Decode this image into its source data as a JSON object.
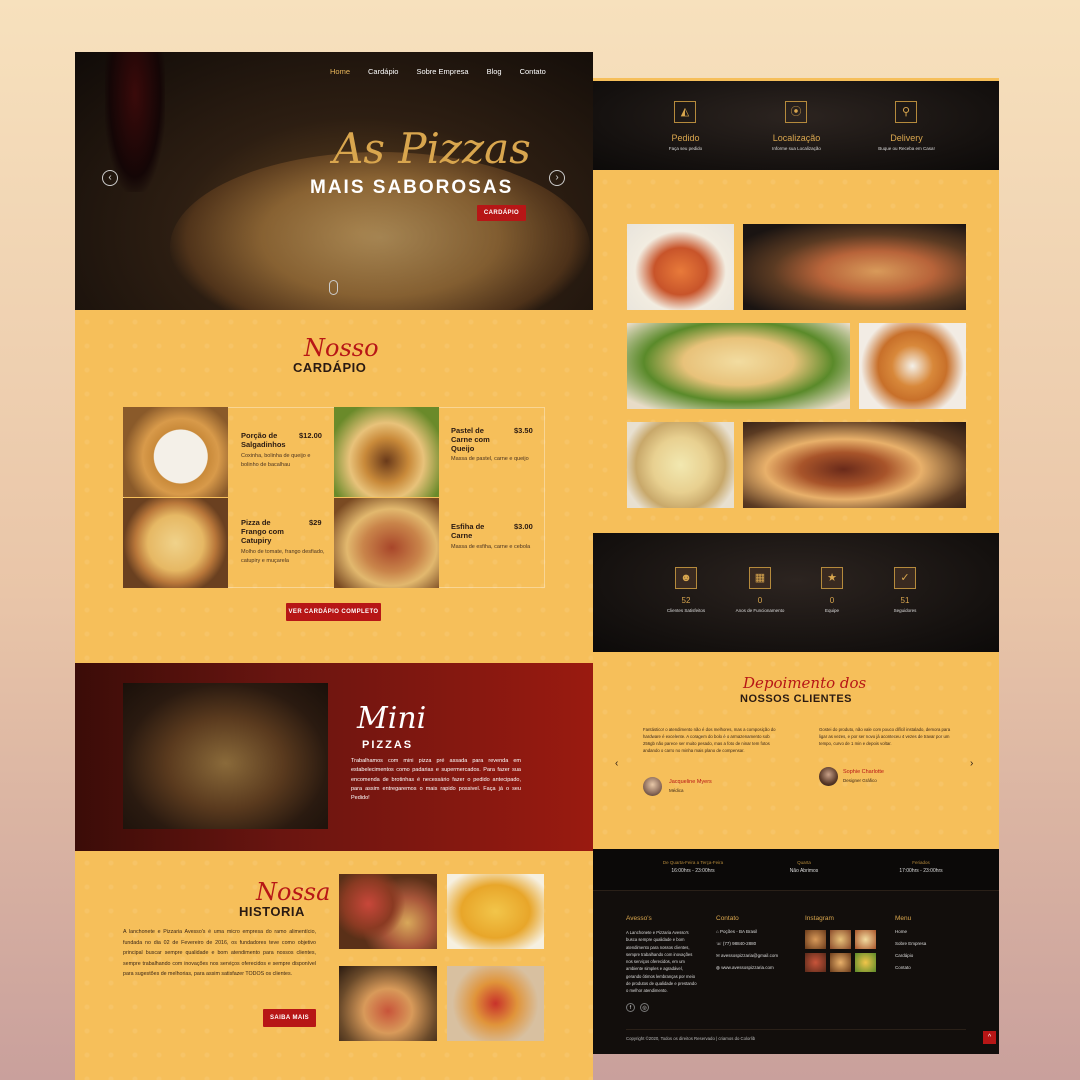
{
  "hero": {
    "nav": [
      "Home",
      "Cardápio",
      "Sobre Empresa",
      "Blog",
      "Contato"
    ],
    "script": "As Pizzas",
    "headline": "MAIS SABOROSAS",
    "button": "CARDÁPIO",
    "prev": "‹",
    "next": "›"
  },
  "cardapio": {
    "script": "Nosso",
    "title": "CARDÁPIO",
    "items": [
      {
        "name": "Porção de Salgadinhos",
        "price": "$12.00",
        "desc": "Coxinha, bolinha de queijo e bolinho de bacalhau"
      },
      {
        "name": "Pastel de Carne com Queijo",
        "price": "$3.50",
        "desc": "Massa de pastel, carne e queijo"
      },
      {
        "name": "Pizza de Frango com Catupiry",
        "price": "$29",
        "desc": "Molho de tomate, frango desfiado, catupiry e muçarela"
      },
      {
        "name": "Esfiha de Carne",
        "price": "$3.00",
        "desc": "Massa de esfiha, carne e cebola"
      }
    ],
    "button": "VER CARDÁPIO COMPLETO"
  },
  "mini": {
    "script": "Mini",
    "title": "PIZZAS",
    "text": "Trabalhamos com mini pizza pré assada para revenda em estabelecimentos como padarias e supermercados. Para fazer sua encomenda de brotinhas é necessário fazer o pedido antecipado, para assim entregaremos o mais rapido possivel. Faça já o seu Pedido!"
  },
  "historia": {
    "script": "Nossa",
    "title": "HISTORIA",
    "text": "A lanchonete e Pizzaria Avesso's é uma micro empresa do ramo alimentício, fundada no dia 02 de Fevereiro de 2016, os fundadores teve como objetivo principal buscar sempre qualidade e bom atendimento para nossos clientes, sempre trabalhando com inovações nos serviços oferecidos e sempre disponível para sugestões de melhorias, para assim satisfazer TODOS os clientes.",
    "button": "SAIBA MAIS"
  },
  "services": [
    {
      "icon": "pizza-slice-icon",
      "glyph": "◭",
      "title": "Pedido",
      "sub": "Faça seu pedido"
    },
    {
      "icon": "location-pin-icon",
      "glyph": "⦿",
      "title": "Localização",
      "sub": "Informe sua Localização"
    },
    {
      "icon": "motorcycle-icon",
      "glyph": "⚲",
      "title": "Delivery",
      "sub": "Buque ou Receba em Casa!"
    }
  ],
  "stats": [
    {
      "icon": "users-icon",
      "glyph": "☻",
      "value": "52",
      "label": "Clientes Satisfeitos"
    },
    {
      "icon": "calendar-icon",
      "glyph": "▦",
      "value": "0",
      "label": "Anos de Funcionamento"
    },
    {
      "icon": "star-icon",
      "glyph": "★",
      "value": "0",
      "label": "Equipe"
    },
    {
      "icon": "thumbs-up-icon",
      "glyph": "✓",
      "value": "51",
      "label": "Seguidores"
    }
  ],
  "testimonials": {
    "script": "Depoimento dos",
    "title": "NOSSOS CLIENTES",
    "items": [
      {
        "text": "Fantástico! o atendimento não é dos melhores, mas a composição do hardware é excelente. A coragem do bolo é o armazenamento sob 256gb não parece ser muito pesado, mas a foto de ninar tem fotos andando o carro no minha mais plano de compensar.",
        "name": "Jacqueline Myers",
        "role": "Médica"
      },
      {
        "text": "Gostei do produto, não vale com pouco difícil instalado, demora para ligar as vezes, e por ser novo já aconteceu 4 vezes de travar por um tempo, curvo de 1 min e depois voltar.",
        "name": "Sophie Charlotte",
        "role": "Designer Gráfico"
      }
    ]
  },
  "footer": {
    "hours": [
      {
        "title": "De Quarta-Feira a Terça-Feira",
        "value": "16:00hrs - 23:00hrs"
      },
      {
        "title": "Quarta",
        "value": "Não Abrimos"
      },
      {
        "title": "Feriados",
        "value": "17:00hrs - 23:00hrs"
      }
    ],
    "about_title": "Avesso's",
    "about_text": "A Lanchonete e Pizzaria Avesso's busca sempre qualidade e bom atendimento para nossos clientes, sempre trabalhando com inovações nos serviços oferecidos, em um ambiente simples e agradável, gerando ótimos lembranças por meio de produtos de qualidade e prestando o melhor atendimento.",
    "contact_title": "Contato",
    "contacts": [
      "Poções - BA Brasil",
      "(77) 98840-2880",
      "avessospizzaria@gmail.com",
      "www.avessospizzaria.com"
    ],
    "instagram_title": "Instagram",
    "menu_title": "Menu",
    "menu": [
      "Home",
      "Sobre Empresa",
      "Cardápio",
      "Contato"
    ],
    "copyright": "Copyright ©2020, Todos os direitos Reservado | criamos do Colorlib",
    "totop": "^"
  }
}
